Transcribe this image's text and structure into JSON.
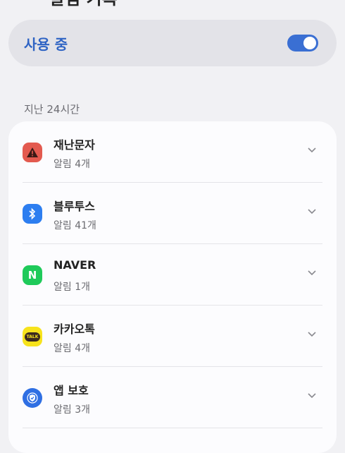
{
  "header": {
    "title": "알림 기록"
  },
  "toggle": {
    "label": "사용 중",
    "on": true,
    "accent": "#3a6fd3"
  },
  "section": {
    "label": "지난 24시간"
  },
  "apps": [
    {
      "name": "재난문자",
      "sub": "알림 4개",
      "icon": "warning-icon"
    },
    {
      "name": "블루투스",
      "sub": "알림 41개",
      "icon": "bluetooth-icon"
    },
    {
      "name": "NAVER",
      "sub": "알림 1개",
      "icon": "naver-icon"
    },
    {
      "name": "카카오톡",
      "sub": "알림 4개",
      "icon": "kakaotalk-icon"
    },
    {
      "name": "앱 보호",
      "sub": "알림 3개",
      "icon": "shield-icon"
    }
  ],
  "icon_text": {
    "naver": "N",
    "kakao": "TALK"
  }
}
